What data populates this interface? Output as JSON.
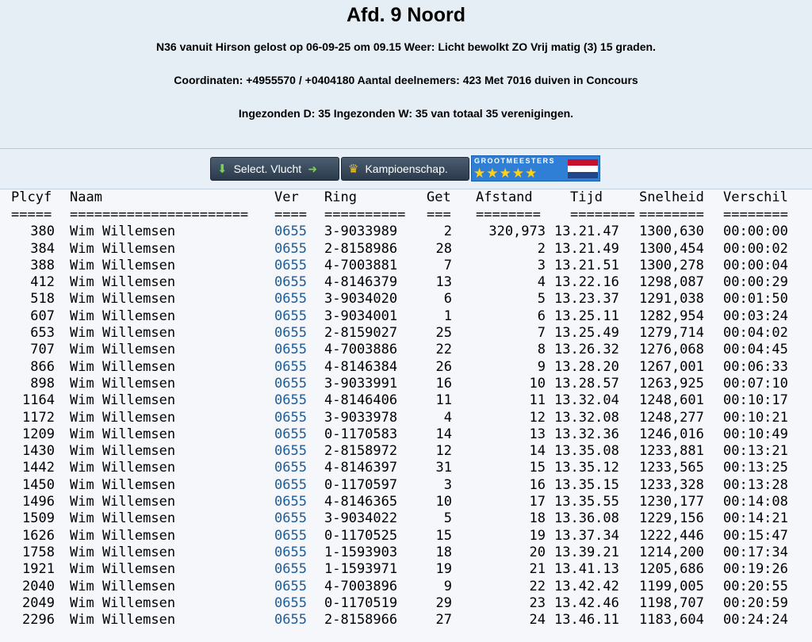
{
  "header": {
    "title": "Afd. 9 Noord",
    "line1": "N36 vanuit Hirson gelost op 06-09-25 om 09.15 Weer: Licht bewolkt ZO Vrij matig (3) 15 graden.",
    "line2": "Coordinaten: +4955570 / +0404180 Aantal deelnemers: 423 Met 7016 duiven in Concours",
    "line3": "Ingezonden D: 35 Ingezonden W: 35 van totaal 35 verenigingen."
  },
  "toolbar": {
    "select_label": "Select. Vlucht",
    "kampioen_label": "Kampioenschap.",
    "grootmeesters_label": "GROOTMEESTERS",
    "colors": {
      "button_bg": "#2b3a4b",
      "gm_bg": "#2f7fd6",
      "star": "#ffd21a"
    }
  },
  "table": {
    "headers": [
      "Plcyf",
      "Naam",
      "Ver",
      "Ring",
      "Get",
      "Afstand",
      "Tijd",
      "Snelheid",
      "Verschil"
    ],
    "separators": [
      "=====",
      "======================",
      "====",
      "==========",
      "===",
      "========",
      "========",
      "========",
      "========"
    ],
    "rows": [
      [
        "380",
        "Wim Willemsen",
        "0655",
        "3-9033989",
        "2",
        "320,973",
        "13.21.47",
        "1300,630",
        "00:00:00"
      ],
      [
        "384",
        "Wim Willemsen",
        "0655",
        "2-8158986",
        "28",
        "2",
        "13.21.49",
        "1300,454",
        "00:00:02"
      ],
      [
        "388",
        "Wim Willemsen",
        "0655",
        "4-7003881",
        "7",
        "3",
        "13.21.51",
        "1300,278",
        "00:00:04"
      ],
      [
        "412",
        "Wim Willemsen",
        "0655",
        "4-8146379",
        "13",
        "4",
        "13.22.16",
        "1298,087",
        "00:00:29"
      ],
      [
        "518",
        "Wim Willemsen",
        "0655",
        "3-9034020",
        "6",
        "5",
        "13.23.37",
        "1291,038",
        "00:01:50"
      ],
      [
        "607",
        "Wim Willemsen",
        "0655",
        "3-9034001",
        "1",
        "6",
        "13.25.11",
        "1282,954",
        "00:03:24"
      ],
      [
        "653",
        "Wim Willemsen",
        "0655",
        "2-8159027",
        "25",
        "7",
        "13.25.49",
        "1279,714",
        "00:04:02"
      ],
      [
        "707",
        "Wim Willemsen",
        "0655",
        "4-7003886",
        "22",
        "8",
        "13.26.32",
        "1276,068",
        "00:04:45"
      ],
      [
        "866",
        "Wim Willemsen",
        "0655",
        "4-8146384",
        "26",
        "9",
        "13.28.20",
        "1267,001",
        "00:06:33"
      ],
      [
        "898",
        "Wim Willemsen",
        "0655",
        "3-9033991",
        "16",
        "10",
        "13.28.57",
        "1263,925",
        "00:07:10"
      ],
      [
        "1164",
        "Wim Willemsen",
        "0655",
        "4-8146406",
        "11",
        "11",
        "13.32.04",
        "1248,601",
        "00:10:17"
      ],
      [
        "1172",
        "Wim Willemsen",
        "0655",
        "3-9033978",
        "4",
        "12",
        "13.32.08",
        "1248,277",
        "00:10:21"
      ],
      [
        "1209",
        "Wim Willemsen",
        "0655",
        "0-1170583",
        "14",
        "13",
        "13.32.36",
        "1246,016",
        "00:10:49"
      ],
      [
        "1430",
        "Wim Willemsen",
        "0655",
        "2-8158972",
        "12",
        "14",
        "13.35.08",
        "1233,881",
        "00:13:21"
      ],
      [
        "1442",
        "Wim Willemsen",
        "0655",
        "4-8146397",
        "31",
        "15",
        "13.35.12",
        "1233,565",
        "00:13:25"
      ],
      [
        "1450",
        "Wim Willemsen",
        "0655",
        "0-1170597",
        "3",
        "16",
        "13.35.15",
        "1233,328",
        "00:13:28"
      ],
      [
        "1496",
        "Wim Willemsen",
        "0655",
        "4-8146365",
        "10",
        "17",
        "13.35.55",
        "1230,177",
        "00:14:08"
      ],
      [
        "1509",
        "Wim Willemsen",
        "0655",
        "3-9034022",
        "5",
        "18",
        "13.36.08",
        "1229,156",
        "00:14:21"
      ],
      [
        "1626",
        "Wim Willemsen",
        "0655",
        "0-1170525",
        "15",
        "19",
        "13.37.34",
        "1222,446",
        "00:15:47"
      ],
      [
        "1758",
        "Wim Willemsen",
        "0655",
        "1-1593903",
        "18",
        "20",
        "13.39.21",
        "1214,200",
        "00:17:34"
      ],
      [
        "1921",
        "Wim Willemsen",
        "0655",
        "1-1593971",
        "19",
        "21",
        "13.41.13",
        "1205,686",
        "00:19:26"
      ],
      [
        "2040",
        "Wim Willemsen",
        "0655",
        "4-7003896",
        "9",
        "22",
        "13.42.42",
        "1199,005",
        "00:20:55"
      ],
      [
        "2049",
        "Wim Willemsen",
        "0655",
        "0-1170519",
        "29",
        "23",
        "13.42.46",
        "1198,707",
        "00:20:59"
      ],
      [
        "2296",
        "Wim Willemsen",
        "0655",
        "2-8158966",
        "27",
        "24",
        "13.46.11",
        "1183,604",
        "00:24:24"
      ]
    ]
  }
}
